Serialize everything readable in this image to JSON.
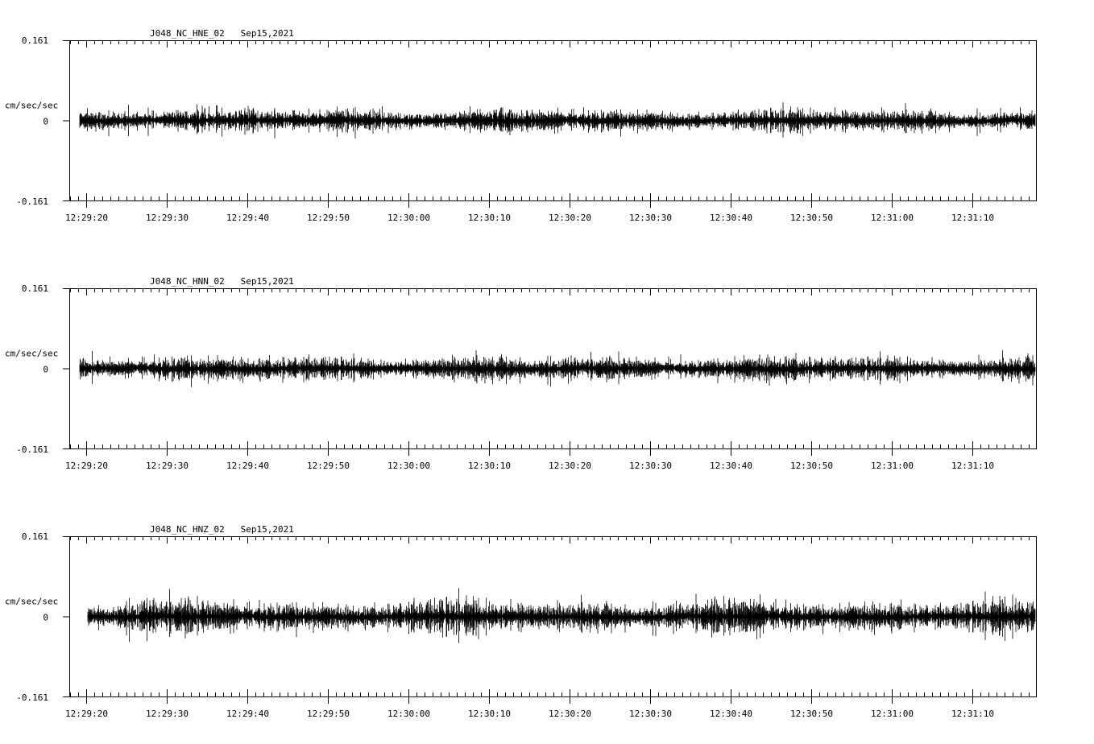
{
  "chart_data": [
    {
      "type": "line",
      "title": "J048_NC_HNE_02   Sep15,2021",
      "ylabel": "cm/sec/sec",
      "ylim": [
        -0.161,
        0.161
      ],
      "y_tick_labels": [
        "0.161",
        "0",
        "-0.161"
      ],
      "x_tick_labels": [
        "12:29:20",
        "12:29:30",
        "12:29:40",
        "12:29:50",
        "12:30:00",
        "12:30:10",
        "12:30:20",
        "12:30:30",
        "12:30:40",
        "12:30:50",
        "12:31:00",
        "12:31:10"
      ],
      "x_start": "12:29:18",
      "x_end": "12:31:17",
      "series": [
        {
          "start": "12:29:19",
          "end": "12:31:17",
          "typical_amplitude": 0.012,
          "peak_amplitude": 0.04
        }
      ],
      "grid": false
    },
    {
      "type": "line",
      "title": "J048_NC_HNN_02   Sep15,2021",
      "ylabel": "cm/sec/sec",
      "ylim": [
        -0.161,
        0.161
      ],
      "y_tick_labels": [
        "0.161",
        "0",
        "-0.161"
      ],
      "x_tick_labels": [
        "12:29:20",
        "12:29:30",
        "12:29:40",
        "12:29:50",
        "12:30:00",
        "12:30:10",
        "12:30:20",
        "12:30:30",
        "12:30:40",
        "12:30:50",
        "12:31:00",
        "12:31:10"
      ],
      "x_start": "12:29:18",
      "x_end": "12:31:17",
      "series": [
        {
          "start": "12:29:19",
          "end": "12:31:17",
          "typical_amplitude": 0.013,
          "peak_amplitude": 0.042
        }
      ],
      "grid": false
    },
    {
      "type": "line",
      "title": "J048_NC_HNZ_02   Sep15,2021",
      "ylabel": "cm/sec/sec",
      "ylim": [
        -0.161,
        0.161
      ],
      "y_tick_labels": [
        "0.161",
        "0",
        "-0.161"
      ],
      "x_tick_labels": [
        "12:29:20",
        "12:29:30",
        "12:29:40",
        "12:29:50",
        "12:30:00",
        "12:30:10",
        "12:30:20",
        "12:30:30",
        "12:30:40",
        "12:30:50",
        "12:31:00",
        "12:31:10"
      ],
      "x_start": "12:29:18",
      "x_end": "12:31:17",
      "series": [
        {
          "start": "12:29:20",
          "end": "12:31:17",
          "typical_amplitude": 0.018,
          "peak_amplitude": 0.05
        }
      ],
      "grid": false
    }
  ],
  "colors": {
    "trace": "#000000",
    "axis": "#000000",
    "background": "#ffffff"
  }
}
